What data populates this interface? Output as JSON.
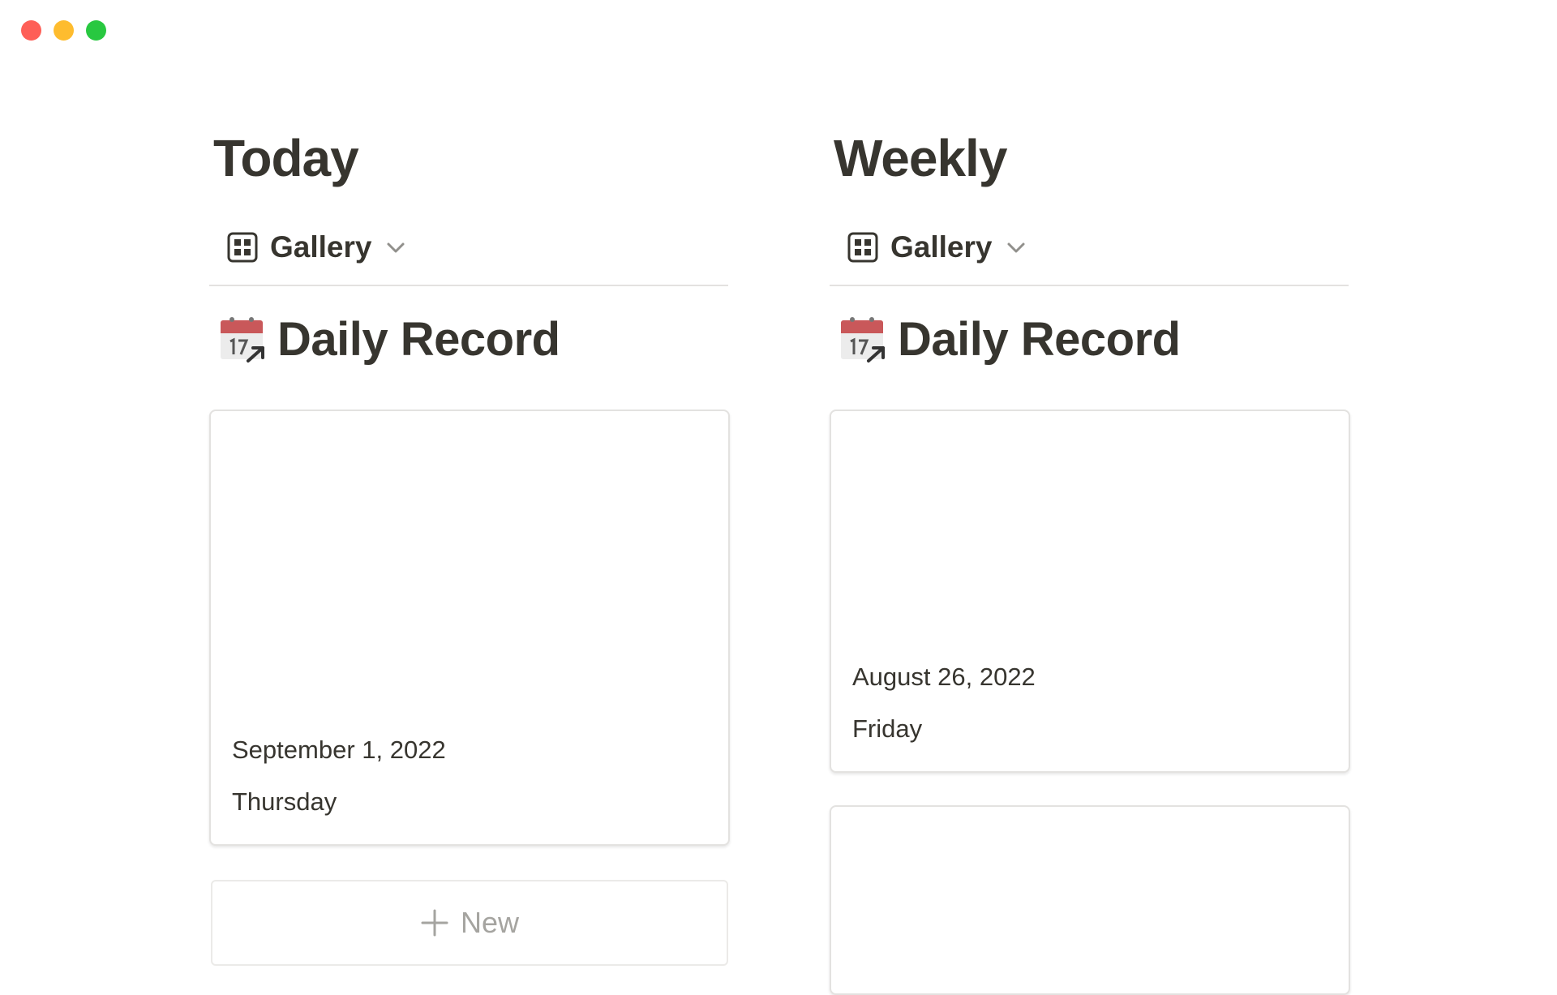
{
  "window": {
    "controls": [
      "close",
      "minimize",
      "zoom"
    ]
  },
  "columns": [
    {
      "title": "Today",
      "view": {
        "label": "Gallery",
        "icon": "gallery-grid-icon"
      },
      "database": {
        "icon": "calendar-icon",
        "title": "Daily Record"
      },
      "cards": [
        {
          "date": "September 1, 2022",
          "weekday": "Thursday"
        }
      ],
      "new_button": {
        "label": "New",
        "icon": "plus-icon"
      }
    },
    {
      "title": "Weekly",
      "view": {
        "label": "Gallery",
        "icon": "gallery-grid-icon"
      },
      "database": {
        "icon": "calendar-icon",
        "title": "Daily Record"
      },
      "cards": [
        {
          "date": "August 26, 2022",
          "weekday": "Friday"
        },
        {
          "date": "",
          "weekday": ""
        }
      ]
    }
  ],
  "colors": {
    "text": "#37352f",
    "muted": "#a5a4a0",
    "border": "#e3e2e0",
    "close": "#fe5f57",
    "minimize": "#febc2e",
    "zoom": "#28c840"
  }
}
